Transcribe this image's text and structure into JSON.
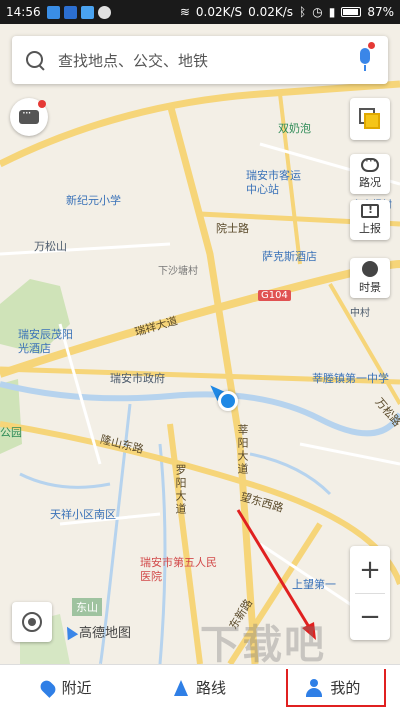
{
  "status_bar": {
    "time": "14:56",
    "net_speed_1": "0.02K/S",
    "net_speed_2": "0.02K/s",
    "battery": "87%"
  },
  "search": {
    "placeholder": "查找地点、公交、地铁"
  },
  "right_tools": {
    "traffic_label": "路况",
    "report_label": "上报",
    "timescene_label": "时景"
  },
  "zoom": {
    "in_label": "+",
    "out_label": "−"
  },
  "brand": {
    "name": "高德地图"
  },
  "map_labels": {
    "road_1": "瑞祥大道",
    "road_2": "隆山东路",
    "road_3": "罗阳大道",
    "road_4": "望东西路",
    "road_5": "东新路",
    "road_6": "院士路",
    "road_7": "莘阳大道",
    "road_8": "万松路",
    "poi_1": "双奶泡",
    "poi_2": "瑞安市客运中心站",
    "poi_3": "新纪元小学",
    "poi_4": "萨克斯酒店",
    "poi_5": "万松山",
    "poi_6": "下沙塘村",
    "poi_7": "瑞安辰茂阳光酒店",
    "poi_8": "瑞安市政府",
    "poi_9": "莘塍镇第一中学",
    "poi_10": "天祥小区南区",
    "poi_11": "瑞安市第五人民医院",
    "poi_12": "东山",
    "poi_13": "上望第一",
    "poi_14": "中村",
    "poi_15": "公园",
    "poi_16": "上山根村",
    "highway": "G104"
  },
  "bottom_nav": {
    "nearby": "附近",
    "route": "路线",
    "mine": "我的"
  },
  "watermark": "下载吧",
  "colors": {
    "accent": "#2f7fe6",
    "annotation": "#e02020"
  }
}
